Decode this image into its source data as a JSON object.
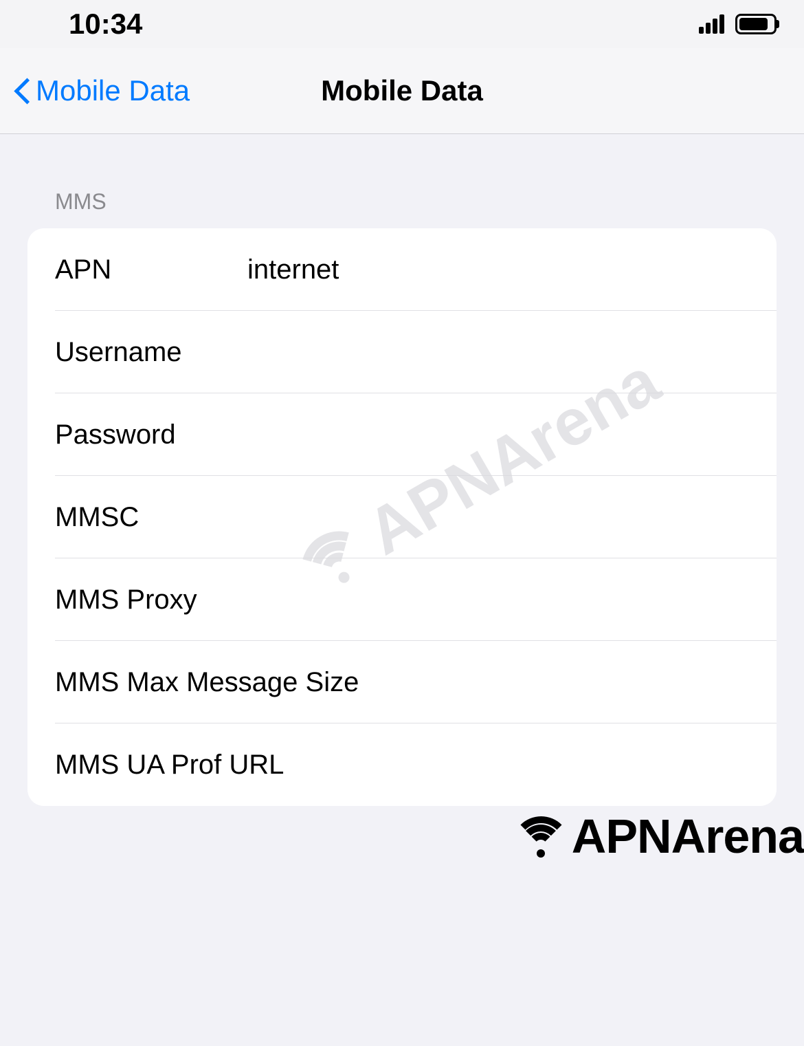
{
  "status": {
    "time": "10:34"
  },
  "nav": {
    "back_label": "Mobile Data",
    "title": "Mobile Data"
  },
  "section": {
    "header": "MMS",
    "rows": [
      {
        "label": "APN",
        "value": "internet"
      },
      {
        "label": "Username",
        "value": ""
      },
      {
        "label": "Password",
        "value": ""
      },
      {
        "label": "MMSC",
        "value": ""
      },
      {
        "label": "MMS Proxy",
        "value": ""
      },
      {
        "label": "MMS Max Message Size",
        "value": ""
      },
      {
        "label": "MMS UA Prof URL",
        "value": ""
      }
    ]
  },
  "watermark": {
    "text": "APNArena"
  },
  "footer": {
    "brand": "APNArena"
  }
}
